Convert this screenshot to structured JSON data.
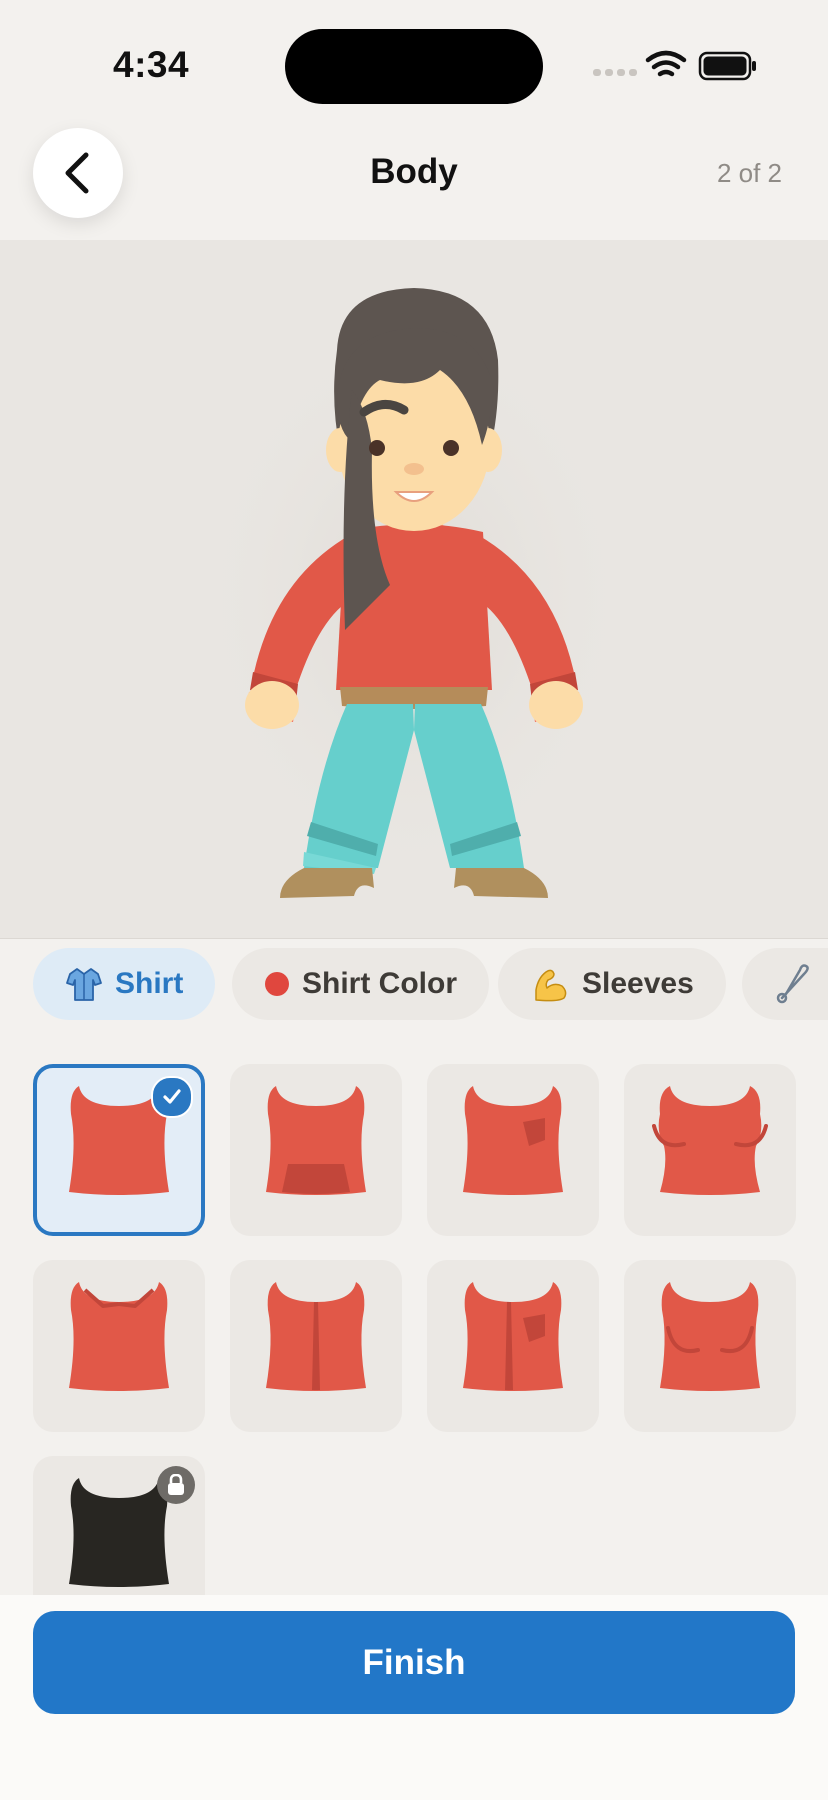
{
  "status_bar": {
    "time": "4:34"
  },
  "header": {
    "title": "Body",
    "step": "2 of 2"
  },
  "tabs": [
    {
      "label": "Shirt",
      "icon": "shirt-icon",
      "active": true
    },
    {
      "label": "Shirt Color",
      "icon": "red-dot-icon",
      "active": false
    },
    {
      "label": "Sleeves",
      "icon": "flexed-biceps-icon",
      "active": false
    },
    {
      "label": "",
      "icon": "safety-pin-icon",
      "active": false
    }
  ],
  "shirt_options": [
    {
      "style": "plain",
      "color": "#e15848",
      "selected": true,
      "locked": false
    },
    {
      "style": "tie-front",
      "color": "#e15848",
      "selected": false,
      "locked": false
    },
    {
      "style": "pocket",
      "color": "#e15848",
      "selected": false,
      "locked": false
    },
    {
      "style": "fitted",
      "color": "#e15848",
      "selected": false,
      "locked": false
    },
    {
      "style": "collared",
      "color": "#e15848",
      "selected": false,
      "locked": false
    },
    {
      "style": "zip-front",
      "color": "#e15848",
      "selected": false,
      "locked": false
    },
    {
      "style": "zip-pocket",
      "color": "#e15848",
      "selected": false,
      "locked": false
    },
    {
      "style": "fitted-curves",
      "color": "#e15848",
      "selected": false,
      "locked": false
    },
    {
      "style": "plain-black",
      "color": "#282622",
      "selected": false,
      "locked": true
    }
  ],
  "footer": {
    "finish_label": "Finish"
  },
  "colors": {
    "accent": "#2277c8",
    "shirt": "#e15848",
    "pants": "#66cfcc",
    "hair": "#5d5550",
    "skin": "#fcdca8"
  }
}
